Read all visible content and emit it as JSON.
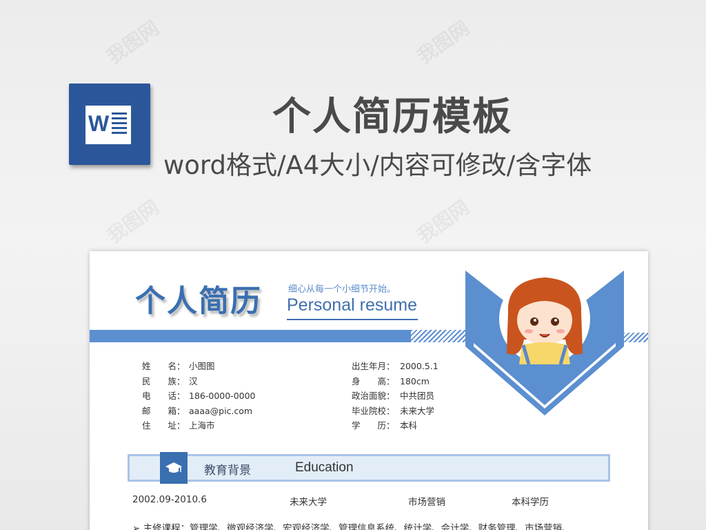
{
  "header": {
    "title": "个人简历模板",
    "subtitle": "word格式/A4大小/内容可修改/含字体",
    "app_icon": "word-icon",
    "app_icon_letter": "W"
  },
  "resume": {
    "title": "个人简历",
    "slogan": "细心从每一个小细节开始。",
    "title_en": "Personal resume",
    "accent_color": "#5b8fd0",
    "info_left": [
      {
        "label": "姓　　名：",
        "value": "小图图"
      },
      {
        "label": "民　　族：",
        "value": "汉"
      },
      {
        "label": "电　　话：",
        "value": "186-0000-0000"
      },
      {
        "label": "邮　　箱：",
        "value": "aaaa@pic.com"
      },
      {
        "label": "住　　址：",
        "value": "上海市"
      }
    ],
    "info_right": [
      {
        "label": "出生年月：",
        "value": "2000.5.1"
      },
      {
        "label": "身　　高：",
        "value": "180cm"
      },
      {
        "label": "政治面貌：",
        "value": "中共团员"
      },
      {
        "label": "毕业院校：",
        "value": "未来大学"
      },
      {
        "label": "学　　历：",
        "value": "本科"
      }
    ],
    "education": {
      "section_cn": "教育背景",
      "section_en": "Education",
      "icon": "graduation-cap-icon",
      "period": "2002.09-2010.6",
      "school": "未来大学",
      "major": "市场营销",
      "degree": "本科学历",
      "courses": "➢ 主修课程：管理学、微观经济学、宏观经济学、管理信息系统、统计学、会计学、财务管理、市场营销、"
    }
  }
}
